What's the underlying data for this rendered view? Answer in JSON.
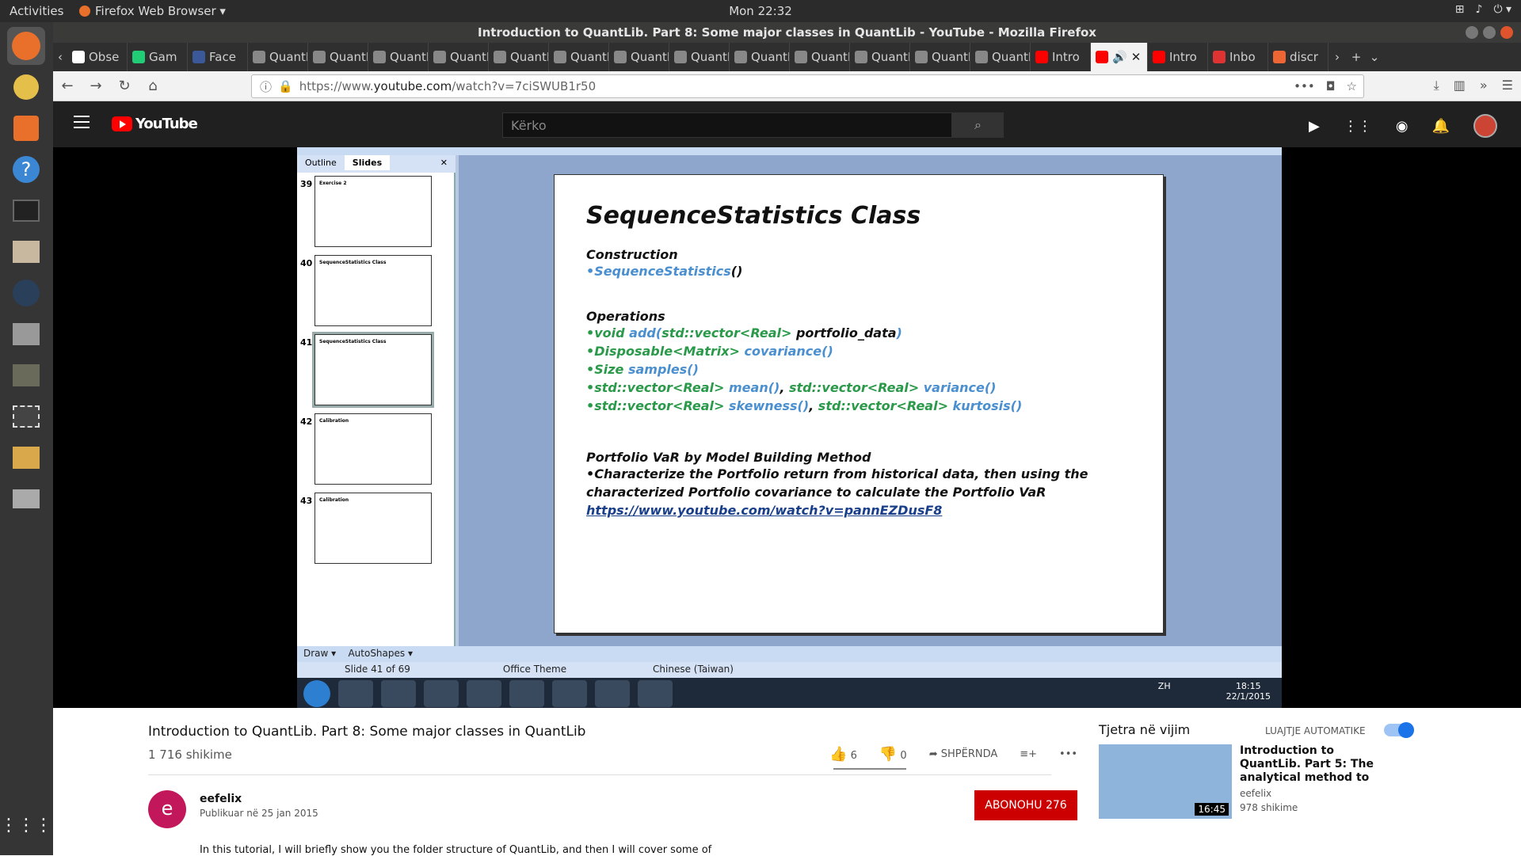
{
  "topbar": {
    "activities": "Activities",
    "app": "Firefox Web Browser ▾",
    "clock": "Mon 22:32"
  },
  "window": {
    "title": "Introduction to QuantLib. Part 8: Some major classes in QuantLib - YouTube - Mozilla Firefox"
  },
  "tabs": [
    {
      "label": "Obse",
      "color": "#fff"
    },
    {
      "label": "Gam",
      "color": "#2c7"
    },
    {
      "label": "Face",
      "color": "#3b5998"
    },
    {
      "label": "QuantLi",
      "color": "#888"
    },
    {
      "label": "QuantLi",
      "color": "#888"
    },
    {
      "label": "QuantLi",
      "color": "#888"
    },
    {
      "label": "QuantLi",
      "color": "#888"
    },
    {
      "label": "QuantLi",
      "color": "#888"
    },
    {
      "label": "QuantLi",
      "color": "#888"
    },
    {
      "label": "QuantLi",
      "color": "#888"
    },
    {
      "label": "QuantLi",
      "color": "#888"
    },
    {
      "label": "QuantLi",
      "color": "#888"
    },
    {
      "label": "QuantLi",
      "color": "#888"
    },
    {
      "label": "QuantLi",
      "color": "#888"
    },
    {
      "label": "QuantLi",
      "color": "#888"
    },
    {
      "label": "QuantLi",
      "color": "#888"
    },
    {
      "label": "Intro",
      "color": "#f00"
    }
  ],
  "active_tab": {
    "label": "",
    "color": "#f00"
  },
  "tabs_after": [
    {
      "label": "Intro",
      "color": "#f00"
    },
    {
      "label": "Inbo",
      "color": "#d33"
    },
    {
      "label": "discr",
      "color": "#e63"
    }
  ],
  "url": {
    "prefix": "https://www.",
    "domain": "youtube.com",
    "path": "/watch?v=7ciSWUB1r50"
  },
  "youtube": {
    "logo": "YouTube",
    "search_placeholder": "Kërko"
  },
  "ppt": {
    "tab_outline": "Outline",
    "tab_slides": "Slides",
    "thumbs": [
      {
        "num": "39",
        "text": "Exercise 2"
      },
      {
        "num": "40",
        "text": "SequenceStatistics Class"
      },
      {
        "num": "41",
        "text": "SequenceStatistics Class"
      },
      {
        "num": "42",
        "text": "Calibration"
      },
      {
        "num": "43",
        "text": "Calibration"
      }
    ],
    "slide": {
      "title": "SequenceStatistics Class",
      "construction": "Construction",
      "c1": "•SequenceStatistics",
      "c1b": "()",
      "operations": "Operations",
      "o1a": "•void",
      "o1b": " add(",
      "o1c": "std::vector<Real>",
      "o1d": " portfolio_data",
      "o1e": ")",
      "o2a": "•Disposable<Matrix>",
      "o2b": "  covariance()",
      "o3a": "•Size",
      "o3b": "  samples()",
      "o4a": "•std::vector<Real>",
      "o4b": " mean()",
      "o4c": ", ",
      "o4d": "std::vector<Real>",
      "o4e": " variance()",
      "o5a": "•std::vector<Real>",
      "o5b": " skewness()",
      "o5c": ", ",
      "o5d": "std::vector<Real>",
      "o5e": " kurtosis()",
      "var": "Portfolio VaR by Model Building Method",
      "v1": "•Characterize the Portfolio return from historical data, then using the",
      "v2": "characterized Portfolio covariance to calculate the Portfolio VaR",
      "link": "https://www.youtube.com/watch?v=pannEZDusF8"
    },
    "draw": "Draw ▾",
    "autoshapes": "AutoShapes ▾",
    "status_slide": "Slide 41 of 69",
    "status_theme": "Office Theme",
    "status_lang": "Chinese (Taiwan)",
    "win_lang": "ZH",
    "win_time": "18:15",
    "win_date": "22/1/2015"
  },
  "video": {
    "title": "Introduction to QuantLib. Part 8: Some major classes in QuantLib",
    "views": "1 716 shikime",
    "likes": "6",
    "dislikes": "0",
    "share": "SHPËRNDA",
    "channel": "eefelix",
    "channel_initial": "e",
    "published": "Publikuar në 25 jan 2015",
    "subscribe": "ABONOHU  276",
    "description": "In this tutorial, I will briefly show you the folder structure of QuantLib, and then I will cover some of"
  },
  "side": {
    "up_next": "Tjetra në vijim",
    "autoplay": "LUAJTJE AUTOMATIKE",
    "rec_title": "Introduction to QuantLib. Part 5: The analytical method to",
    "rec_channel": "eefelix",
    "rec_views": "978 shikime",
    "rec_duration": "16:45"
  }
}
